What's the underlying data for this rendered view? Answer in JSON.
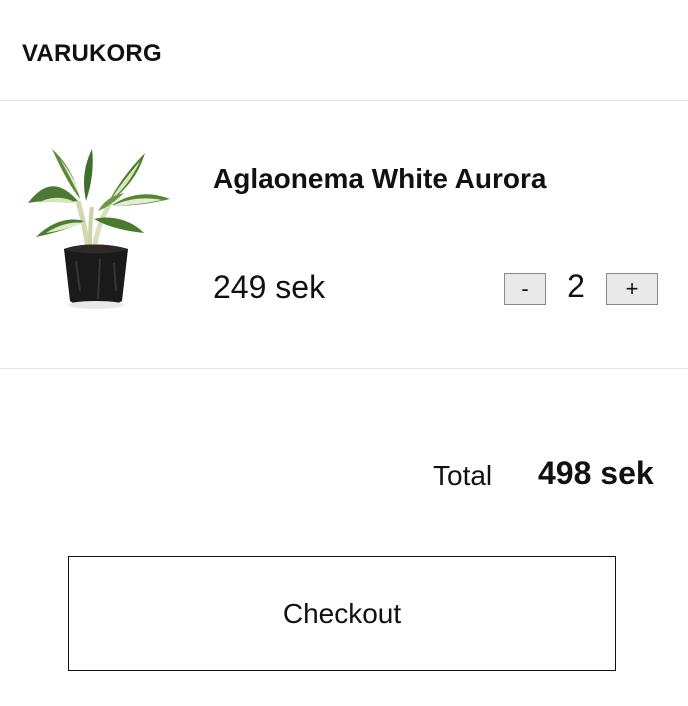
{
  "header": {
    "title": "VARUKORG"
  },
  "cart": {
    "items": [
      {
        "name": "Aglaonema White Aurora",
        "price": "249 sek",
        "quantity": "2",
        "image_icon": "potted-plant-image",
        "decrement_label": "-",
        "increment_label": "+"
      }
    ]
  },
  "summary": {
    "total_label": "Total",
    "total_value": "498 sek"
  },
  "checkout": {
    "label": "Checkout"
  }
}
